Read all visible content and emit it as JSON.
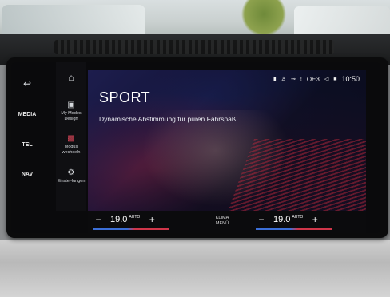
{
  "side_menu": {
    "back_icon": "back-arrow-icon",
    "media": "MEDIA",
    "tel": "TEL",
    "nav": "NAV"
  },
  "panel_menu": {
    "home_icon": "home-icon",
    "items": [
      {
        "label": "My Modes Design",
        "icon": "image-icon"
      },
      {
        "label": "Modus wechseln",
        "icon": "modes-switch-icon"
      },
      {
        "label": "Einstel-lungen",
        "icon": "gear-icon"
      }
    ]
  },
  "main": {
    "title": "SPORT",
    "subtitle": "Dynamische Abstimmung für puren Fahrspaß."
  },
  "status_bar": {
    "text": "OE3",
    "time": "10:50",
    "icons": [
      "bluetooth-icon",
      "user-icon",
      "mute-icon",
      "alert-icon",
      "speaker-icon",
      "phone-icon"
    ]
  },
  "climate": {
    "left_temp": "19.0",
    "left_mode": "AUTO",
    "right_temp": "19.0",
    "right_mode": "AUTO",
    "minus": "−",
    "plus": "+",
    "menu_label_1": "KLIMA",
    "menu_label_2": "MENÜ"
  },
  "colors": {
    "accent_blue": "#3c6fd8",
    "accent_red": "#d0364a"
  }
}
